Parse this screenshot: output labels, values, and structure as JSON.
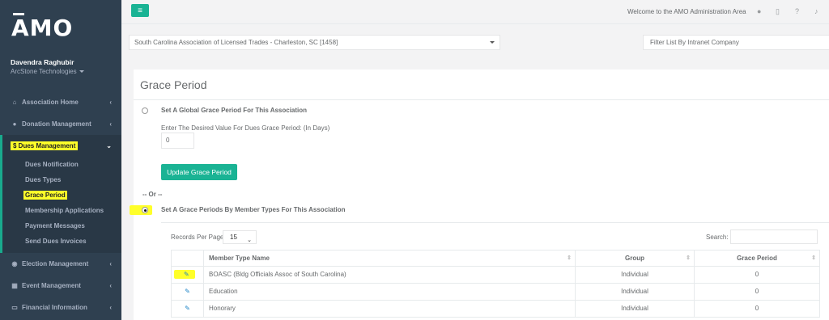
{
  "brand": {
    "logo_text": "AMO"
  },
  "user": {
    "name": "Davendra Raghubir",
    "company": "ArcStone Technologies"
  },
  "sidebar": {
    "items": [
      {
        "label": "Association Home",
        "icon": "home-icon"
      },
      {
        "label": "Donation Management",
        "icon": "info-icon"
      },
      {
        "label": "Dues Management",
        "icon": "dollar-icon"
      },
      {
        "label": "Election Management",
        "icon": "election-icon"
      },
      {
        "label": "Event Management",
        "icon": "calendar-icon"
      },
      {
        "label": "Financial Information",
        "icon": "money-icon"
      }
    ],
    "dues_sub": [
      "Dues Notification",
      "Dues Types",
      "Grace Period",
      "Membership Applications",
      "Payment Messages",
      "Send Dues Invoices"
    ]
  },
  "topbar": {
    "welcome": "Welcome to the AMO Administration Area"
  },
  "association_select": {
    "value": "South Carolina Association of Licensed Trades - Charleston, SC [1458]"
  },
  "company_filter": {
    "placeholder": "Filter List By Intranet Company"
  },
  "page": {
    "title": "Grace Period",
    "option_global": "Set A Global Grace Period For This Association",
    "days_prompt": "Enter The Desired Value For Dues Grace Period: (In Days)",
    "days_value": "0",
    "update_button": "Update Grace Period",
    "or_text": "-- Or --",
    "option_member": "Set A Grace Periods By Member Types For This Association",
    "records_per_page_label": "Records Per Page",
    "records_per_page_value": "15",
    "search_label": "Search:"
  },
  "table": {
    "headers": [
      "Member Type Name",
      "Group",
      "Grace Period"
    ],
    "rows": [
      [
        "BOASC (Bldg Officials Assoc of South Carolina)",
        "Individual",
        "0"
      ],
      [
        "Education",
        "Individual",
        "0"
      ],
      [
        "Honorary",
        "Individual",
        "0"
      ]
    ]
  },
  "colors": {
    "accent": "#1ab394",
    "sidebar": "#2f4050",
    "highlight": "#ffff2a"
  }
}
